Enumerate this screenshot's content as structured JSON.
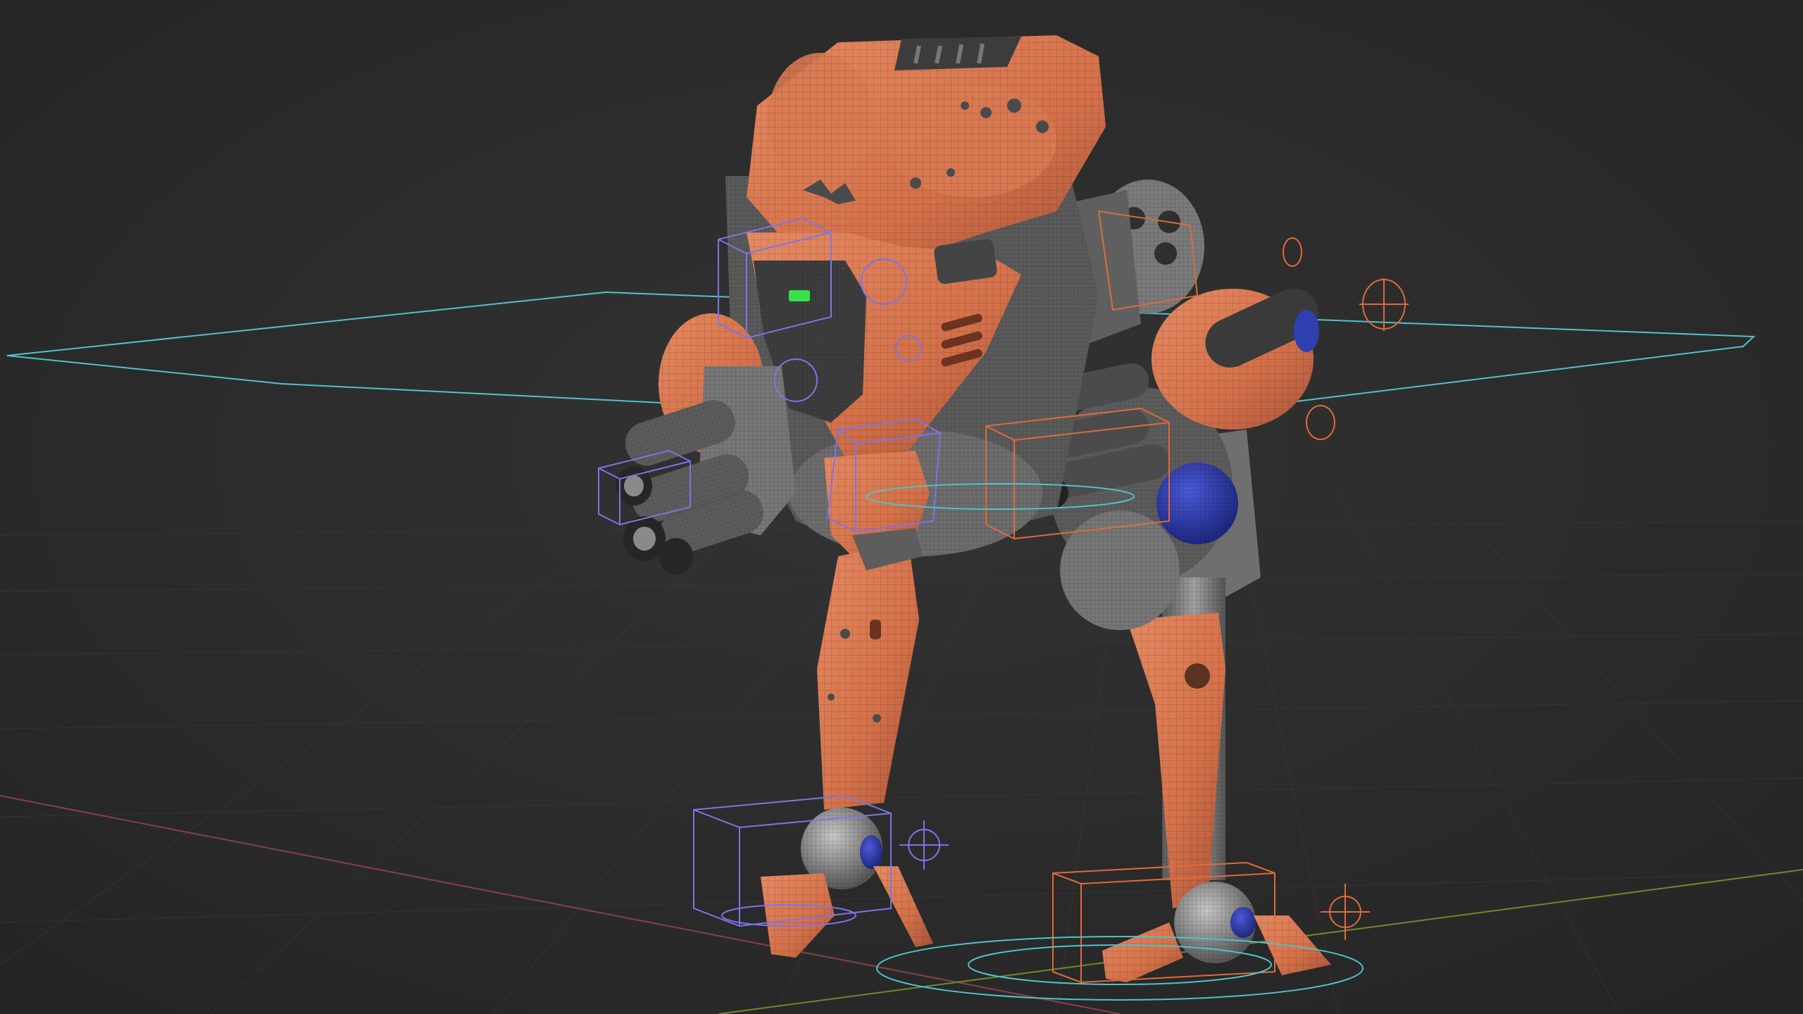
{
  "app": {
    "kind": "3d-viewport"
  },
  "scene": {
    "subject": "mech-robot-rig",
    "colors": {
      "background": "#2a2a2a",
      "grid": "#343434",
      "axis_x": "#8a3f4a",
      "axis_y": "#6a8a2a",
      "armor": "#d9774f",
      "armor_shadow": "#9b4a2e",
      "metal": "#8d8d8d",
      "metal_dark": "#4f4f4f",
      "joint_blue": "#2f3fb0",
      "control_cyan": "#4fc3c8",
      "control_orange": "#e06a3a",
      "control_violet": "#7d74e8",
      "status_light": "#39e04a"
    }
  }
}
